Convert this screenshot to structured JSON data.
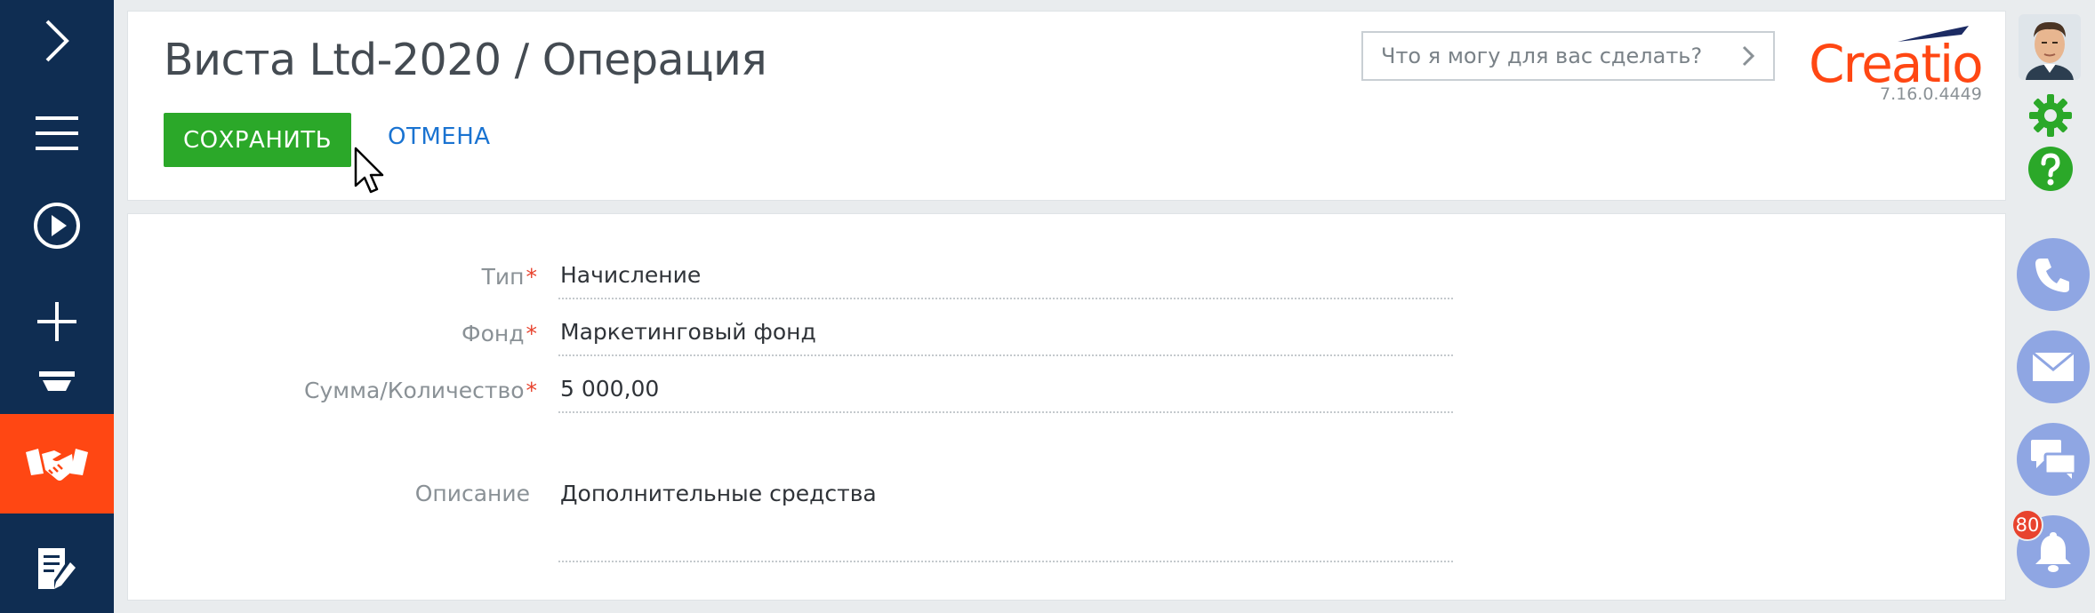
{
  "nav": {
    "items": [
      {
        "name": "expand",
        "icon": "chevron-right-icon"
      },
      {
        "name": "menu",
        "icon": "hamburger-menu-icon"
      },
      {
        "name": "process",
        "icon": "play-circle-icon"
      },
      {
        "name": "create",
        "icon": "plus-icon"
      },
      {
        "name": "funnel",
        "icon": "funnel-icon"
      },
      {
        "name": "deals",
        "icon": "handshake-icon",
        "active": true
      },
      {
        "name": "notes",
        "icon": "edit-document-icon"
      }
    ],
    "colors": {
      "background": "#0f2d52",
      "active": "#ff4713"
    }
  },
  "header": {
    "title": "Виста Ltd-2020 / Операция",
    "save_label": "СОХРАНИТЬ",
    "cancel_label": "ОТМЕНА",
    "search_placeholder": "Что я могу для вас сделать?",
    "logo_text": "Creatio",
    "version": "7.16.0.4449"
  },
  "form": {
    "fields": [
      {
        "label": "Тип",
        "required": "*",
        "value": "Начисление"
      },
      {
        "label": "Фонд",
        "required": "*",
        "value": "Маркетинговый фонд"
      },
      {
        "label": "Сумма/Количество",
        "required": "*",
        "value": "5 000,00"
      }
    ],
    "description": {
      "label": "Описание",
      "value": "Дополнительные средства"
    }
  },
  "right_panel": {
    "buttons": [
      {
        "name": "phone",
        "icon": "phone-icon"
      },
      {
        "name": "email",
        "icon": "envelope-icon"
      },
      {
        "name": "chat",
        "icon": "chat-bubbles-icon"
      },
      {
        "name": "notifications",
        "icon": "bell-icon"
      }
    ],
    "notification_count": "80"
  },
  "colors": {
    "save_button": "#2ba829",
    "link": "#1a73d1",
    "brand": "#ff4713",
    "required": "#e8432e",
    "circle_buttons": "#8fa6e3",
    "settings": "#2ba829"
  }
}
